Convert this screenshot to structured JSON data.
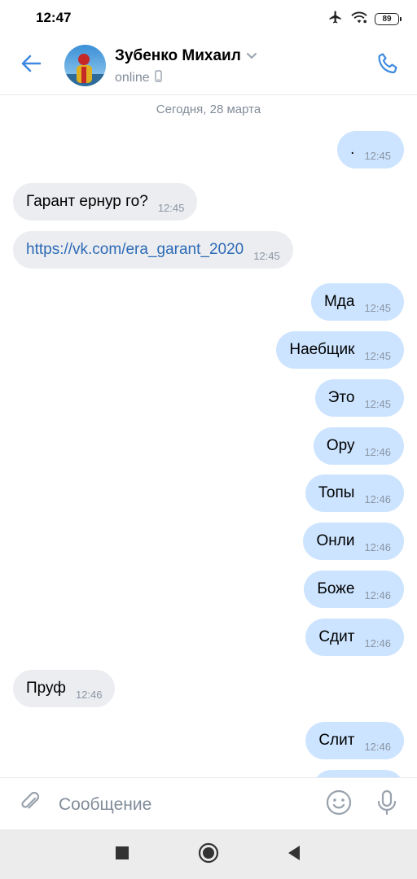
{
  "status_bar": {
    "time": "12:47",
    "battery": "89",
    "icons": [
      "airplane-mode-icon",
      "wifi-icon",
      "battery-icon"
    ]
  },
  "header": {
    "contact_name": "Зубенко Михаил",
    "status": "online",
    "icons": [
      "back-arrow-icon",
      "chevron-down-icon",
      "mobile-device-icon",
      "phone-icon"
    ]
  },
  "chat": {
    "date_separator": "Сегодня, 28 марта",
    "messages": [
      {
        "dir": "out",
        "text": ".",
        "time": "12:45"
      },
      {
        "dir": "in",
        "text": "Гарант ернур го?",
        "time": "12:45"
      },
      {
        "dir": "in",
        "text": "https://vk.com/era_garant_2020",
        "time": "12:45",
        "link": true
      },
      {
        "dir": "out",
        "text": "Мда",
        "time": "12:45"
      },
      {
        "dir": "out",
        "text": "Наебщик",
        "time": "12:45"
      },
      {
        "dir": "out",
        "text": "Это",
        "time": "12:45"
      },
      {
        "dir": "out",
        "text": "Ору",
        "time": "12:46"
      },
      {
        "dir": "out",
        "text": "Топы",
        "time": "12:46"
      },
      {
        "dir": "out",
        "text": "Онли",
        "time": "12:46"
      },
      {
        "dir": "out",
        "text": "Боже",
        "time": "12:46"
      },
      {
        "dir": "out",
        "text": "Сдит",
        "time": "12:46"
      },
      {
        "dir": "in",
        "text": "Пруф",
        "time": "12:46"
      },
      {
        "dir": "out",
        "text": "Слит",
        "time": "12:46"
      }
    ]
  },
  "composer": {
    "placeholder": "Сообщение",
    "value": "",
    "icons": [
      "paperclip-icon",
      "emoji-icon",
      "microphone-icon"
    ]
  },
  "colors": {
    "accent": "#3f8ae0",
    "incoming_bubble": "#ebedf0",
    "outgoing_bubble": "#cce4ff",
    "secondary_text": "#818c99"
  },
  "navbar": {
    "icons": [
      "recent-apps-icon",
      "home-icon",
      "back-icon"
    ]
  }
}
